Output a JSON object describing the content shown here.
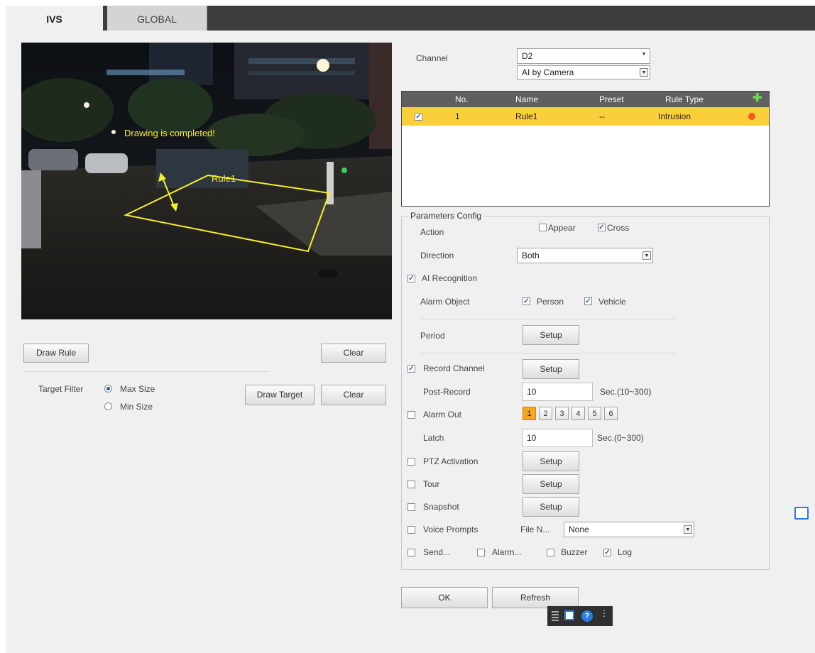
{
  "tabs": [
    {
      "label": "IVS"
    },
    {
      "label": "GLOBAL"
    }
  ],
  "video": {
    "overlay_text": "Drawing is completed!",
    "rule_label": "Rule1"
  },
  "left_buttons": {
    "draw_rule": "Draw Rule",
    "clear_rule": "Clear",
    "draw_target": "Draw Target",
    "clear_target": "Clear"
  },
  "target_filter": {
    "label": "Target Filter",
    "options": [
      "Max Size",
      "Min Size"
    ],
    "selected": "Max Size"
  },
  "channel": {
    "label": "Channel",
    "value": "D2",
    "mode": "AI by Camera"
  },
  "rules_table": {
    "headers": [
      "No.",
      "Name",
      "Preset",
      "Rule Type"
    ],
    "rows": [
      {
        "checked": true,
        "no": "1",
        "name": "Rule1",
        "preset": "--",
        "type": "Intrusion"
      }
    ]
  },
  "params": {
    "title": "Parameters Config",
    "action": {
      "label": "Action",
      "appear": "Appear",
      "cross": "Cross",
      "appear_checked": false,
      "cross_checked": true
    },
    "direction": {
      "label": "Direction",
      "value": "Both"
    },
    "ai_recognition": {
      "label": "AI Recognition",
      "checked": true
    },
    "alarm_object": {
      "label": "Alarm Object",
      "person": "Person",
      "vehicle": "Vehicle"
    },
    "period": {
      "label": "Period",
      "button": "Setup"
    },
    "record_channel": {
      "label": "Record Channel",
      "checked": true,
      "button": "Setup"
    },
    "post_record": {
      "label": "Post-Record",
      "value": "10",
      "unit": "Sec.(10~300)"
    },
    "alarm_out": {
      "label": "Alarm Out",
      "checked": false,
      "channels": [
        "1",
        "2",
        "3",
        "4",
        "5",
        "6"
      ],
      "active": "1"
    },
    "latch": {
      "label": "Latch",
      "value": "10",
      "unit": "Sec.(0~300)"
    },
    "ptz_activation": {
      "label": "PTZ Activation",
      "button": "Setup"
    },
    "tour": {
      "label": "Tour",
      "button": "Setup"
    },
    "snapshot": {
      "label": "Snapshot",
      "button": "Setup"
    },
    "voice_prompts": {
      "label": "Voice Prompts",
      "file_label": "File N...",
      "file_value": "None"
    },
    "bottom_checks": {
      "send": "Send...",
      "alarm": "Alarm...",
      "buzzer": "Buzzer",
      "log": "Log"
    }
  },
  "footer": {
    "ok": "OK",
    "refresh": "Refresh"
  },
  "colors": {
    "tabbar": "#3d3d3d",
    "selected_row": "#fbcf3c",
    "rule_line": "#f5ef2a",
    "active_channel": "#f4a724"
  }
}
